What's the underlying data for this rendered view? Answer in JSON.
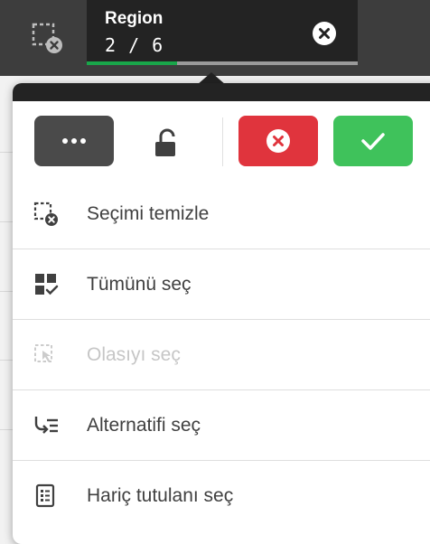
{
  "selection_bar": {
    "field_title": "Region",
    "selection_count": "2 / 6",
    "progress_fraction": 0.333
  },
  "toolbar": {
    "more_icon": "ellipsis-icon",
    "lock_icon": "unlocked-icon",
    "cancel_icon": "x-circle-icon",
    "confirm_icon": "check-icon"
  },
  "menu": {
    "items": [
      {
        "label": "Seçimi temizle",
        "icon": "clear-selection-icon",
        "enabled": true
      },
      {
        "label": "Tümünü seç",
        "icon": "select-all-icon",
        "enabled": true
      },
      {
        "label": "Olasıyı seç",
        "icon": "select-possible-icon",
        "enabled": false
      },
      {
        "label": "Alternatifi seç",
        "icon": "select-alternative-icon",
        "enabled": true
      },
      {
        "label": "Hariç tutulanı seç",
        "icon": "select-excluded-icon",
        "enabled": true
      }
    ]
  },
  "colors": {
    "bar_bg": "#3d3d3d",
    "chip_bg": "#232323",
    "progress": "#19a64a",
    "cancel": "#e0343d",
    "confirm": "#3fc25b",
    "more": "#4a4a4a"
  }
}
